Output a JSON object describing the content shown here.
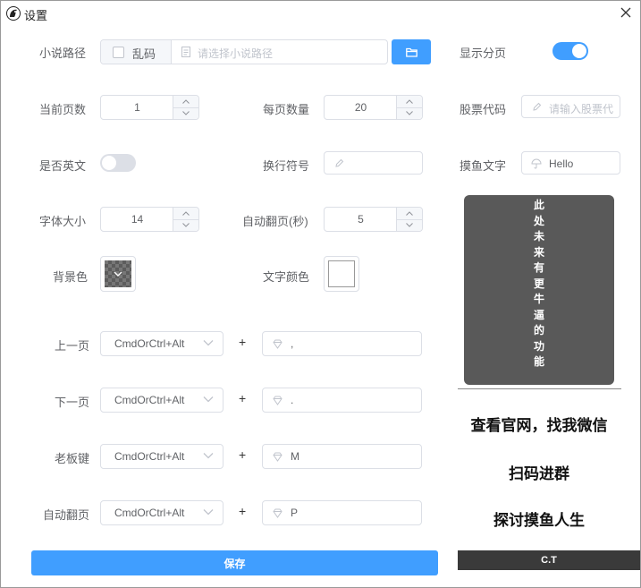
{
  "window": {
    "title": "设置"
  },
  "colors": {
    "accent": "#409eff",
    "toggle_off": "#dcdfe6",
    "dark_box": "#595959"
  },
  "form": {
    "novel_path": {
      "label": "小说路径",
      "garble_label": "乱码",
      "placeholder": "请选择小说路径"
    },
    "show_paging": {
      "label": "显示分页",
      "on": true
    },
    "current_page": {
      "label": "当前页数",
      "value": "1"
    },
    "per_page": {
      "label": "每页数量",
      "value": "20"
    },
    "stock_code": {
      "label": "股票代码",
      "placeholder": "请输入股票代"
    },
    "is_english": {
      "label": "是否英文",
      "on": false
    },
    "line_break": {
      "label": "换行符号",
      "value": ""
    },
    "fish_text": {
      "label": "摸鱼文字",
      "value": "Hello"
    },
    "font_size": {
      "label": "字体大小",
      "value": "14"
    },
    "auto_flip": {
      "label": "自动翻页(秒)",
      "value": "5"
    },
    "bg_color": {
      "label": "背景色"
    },
    "text_color": {
      "label": "文字颜色"
    }
  },
  "shortcuts": [
    {
      "label": "上一页",
      "modifier": "CmdOrCtrl+Alt",
      "key": ","
    },
    {
      "label": "下一页",
      "modifier": "CmdOrCtrl+Alt",
      "key": "."
    },
    {
      "label": "老板键",
      "modifier": "CmdOrCtrl+Alt",
      "key": "M"
    },
    {
      "label": "自动翻页",
      "modifier": "CmdOrCtrl+Alt",
      "key": "P"
    }
  ],
  "plus_sign": "+",
  "side": {
    "future_chars": [
      "此",
      "处",
      "未",
      "来",
      "有",
      "更",
      "牛",
      "逼",
      "的",
      "功",
      "能"
    ],
    "promo1": "查看官网，找我微信",
    "promo2": "扫码进群",
    "promo3": "探讨摸鱼人生",
    "bottom_bar": "C.T"
  },
  "save_label": "保存"
}
